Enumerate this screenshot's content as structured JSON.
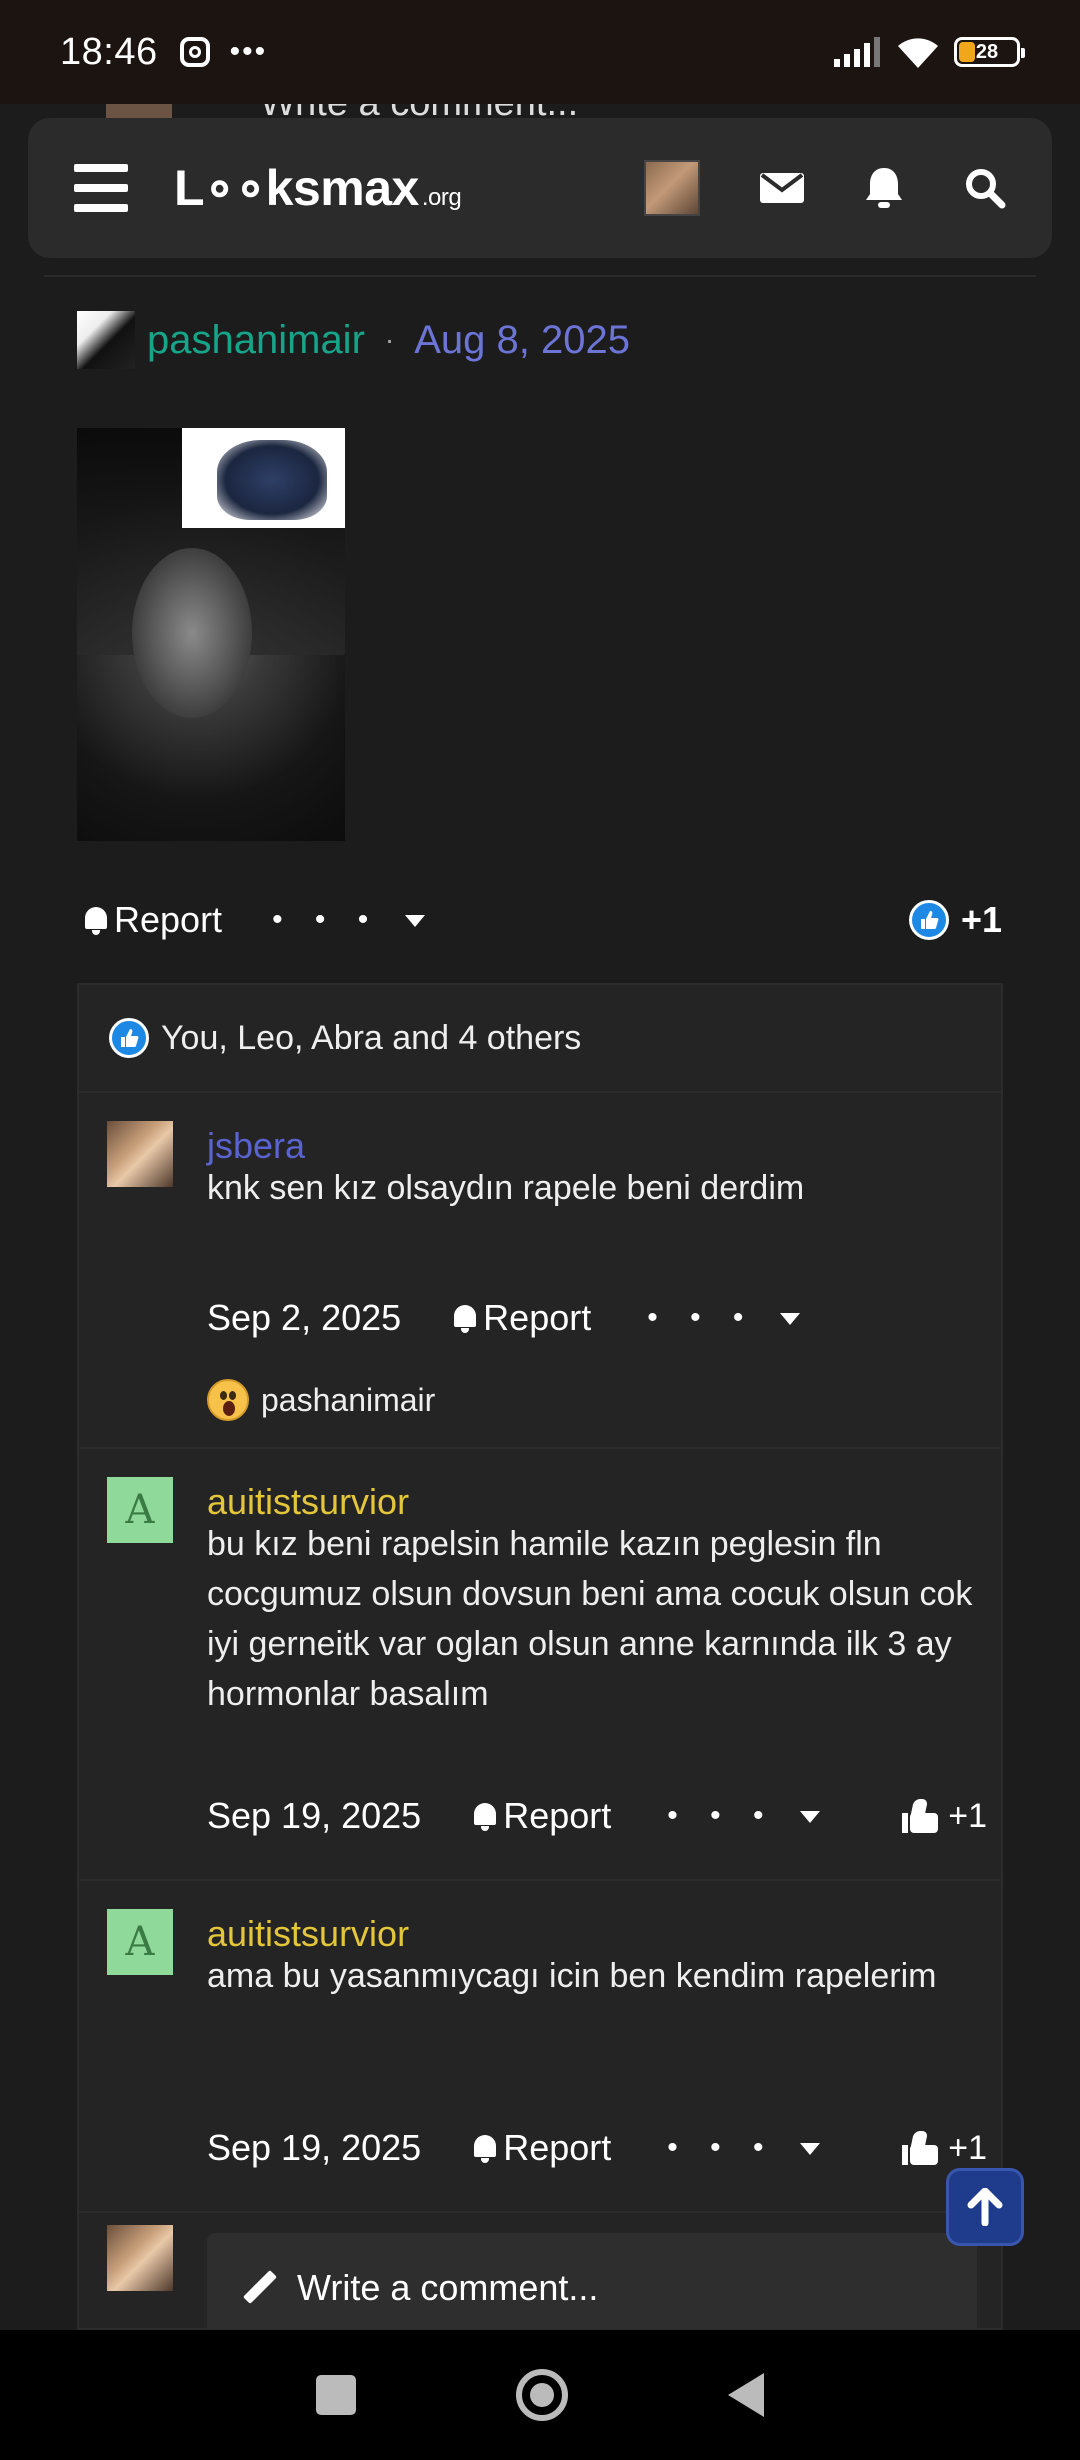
{
  "status": {
    "time": "18:46",
    "more": "•••",
    "battery": "28"
  },
  "behind": {
    "text": "Write a comment..."
  },
  "header": {
    "logo": "L∘∘ksmax",
    "logo_org": ".org"
  },
  "post": {
    "username": "pashanimair",
    "separator": "·",
    "date": "Aug 8, 2025",
    "report_label": "Report",
    "dots": "• • •",
    "like_count": "+1"
  },
  "reactions": {
    "text": "You, Leo, Abra and 4 others"
  },
  "comments": [
    {
      "username": "jsbera",
      "username_color": "#5a63d0",
      "text": "knk sen kız olsaydın rapele beni derdim",
      "date": "Sep 2, 2025",
      "report_label": "Report",
      "dots": "• • •",
      "reaction_user": "pashanimair"
    },
    {
      "username": "auitistsurvior",
      "username_color": "#e3c63a",
      "avatar_letter": "A",
      "text": "bu kız beni rapelsin hamile kazın peglesin fln cocgumuz olsun dovsun beni ama cocuk olsun cok iyi gerneitk var oglan olsun anne karnında ilk 3 ay hormonlar basalım",
      "date": "Sep 19, 2025",
      "report_label": "Report",
      "dots": "• • •",
      "likes": "+1"
    },
    {
      "username": "auitistsurvior",
      "username_color": "#e3c63a",
      "avatar_letter": "A",
      "text": "ama bu yasanmıycagı icin ben kendim rapelerim",
      "date": "Sep 19, 2025",
      "report_label": "Report",
      "dots": "• • •",
      "likes": "+1"
    }
  ],
  "write_comment": {
    "placeholder": "Write a comment..."
  },
  "colors": {
    "accent_green": "#17a58a",
    "accent_blue": "#6c74d6",
    "like_blue": "#1e88e5"
  }
}
